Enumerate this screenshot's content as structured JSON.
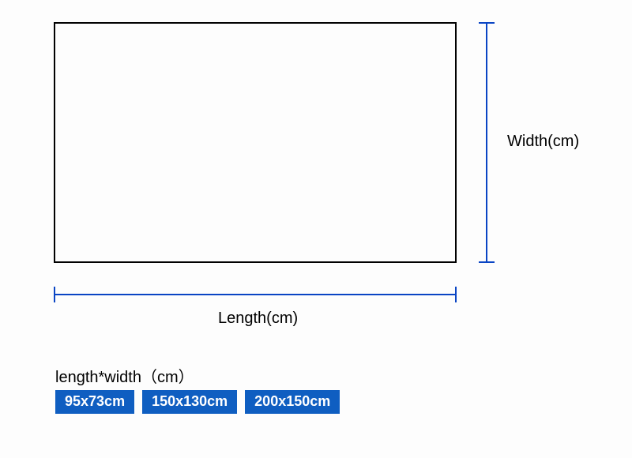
{
  "labels": {
    "width": "Width(cm)",
    "length": "Length(cm)",
    "sizes_title": "length*width（cm）"
  },
  "sizes": [
    "95x73cm",
    "150x130cm",
    "200x150cm"
  ]
}
